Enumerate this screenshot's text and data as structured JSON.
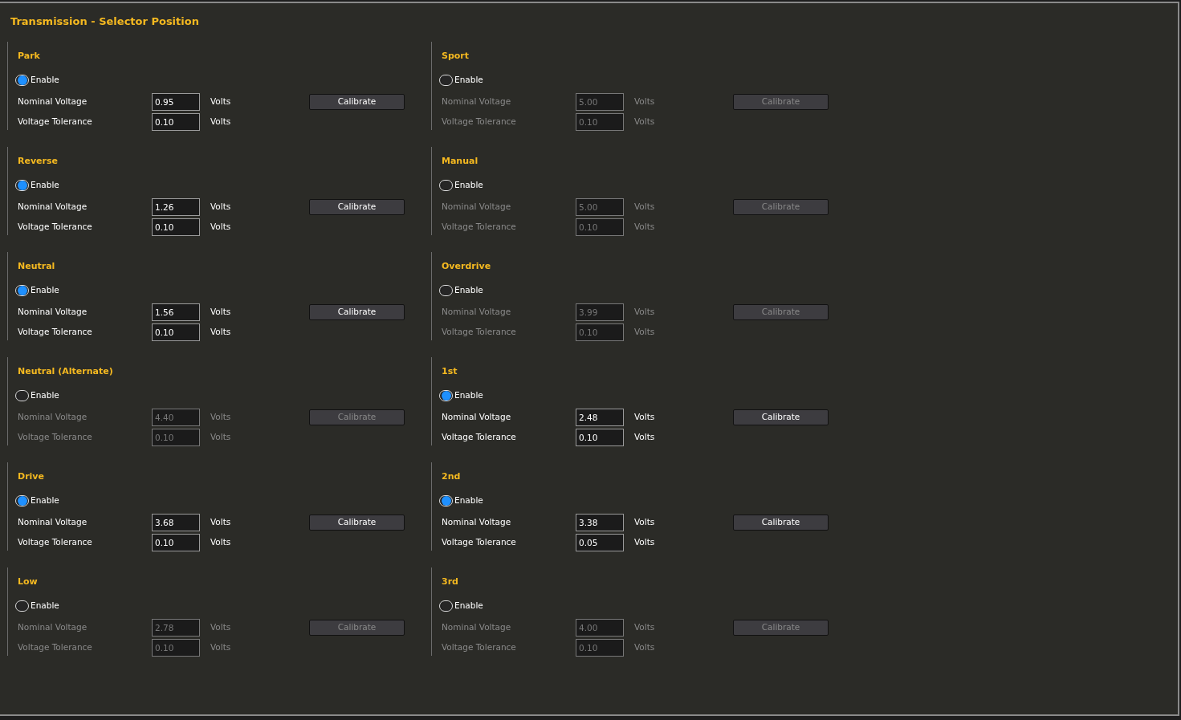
{
  "title": "Transmission - Selector Position",
  "sections": [
    {
      "name": "Park",
      "enabled": true,
      "enable_label": "Enable",
      "nominal_label": "Nominal Voltage",
      "nominal": "0.95",
      "nominal_unit": "Volts",
      "tolerance_label": "Voltage Tolerance",
      "tolerance": "0.10",
      "tolerance_unit": "Volts",
      "button": "Calibrate"
    },
    {
      "name": "Reverse",
      "enabled": true,
      "enable_label": "Enable",
      "nominal_label": "Nominal Voltage",
      "nominal": "1.26",
      "nominal_unit": "Volts",
      "tolerance_label": "Voltage Tolerance",
      "tolerance": "0.10",
      "tolerance_unit": "Volts",
      "button": "Calibrate"
    },
    {
      "name": "Neutral",
      "enabled": true,
      "enable_label": "Enable",
      "nominal_label": "Nominal Voltage",
      "nominal": "1.56",
      "nominal_unit": "Volts",
      "tolerance_label": "Voltage Tolerance",
      "tolerance": "0.10",
      "tolerance_unit": "Volts",
      "button": "Calibrate"
    },
    {
      "name": "Neutral (Alternate)",
      "enabled": false,
      "enable_label": "Enable",
      "nominal_label": "Nominal Voltage",
      "nominal": "4.40",
      "nominal_unit": "Volts",
      "tolerance_label": "Voltage Tolerance",
      "tolerance": "0.10",
      "tolerance_unit": "Volts",
      "button": "Calibrate"
    },
    {
      "name": "Drive",
      "enabled": true,
      "enable_label": "Enable",
      "nominal_label": "Nominal Voltage",
      "nominal": "3.68",
      "nominal_unit": "Volts",
      "tolerance_label": "Voltage Tolerance",
      "tolerance": "0.10",
      "tolerance_unit": "Volts",
      "button": "Calibrate"
    },
    {
      "name": "Low",
      "enabled": false,
      "enable_label": "Enable",
      "nominal_label": "Nominal Voltage",
      "nominal": "2.78",
      "nominal_unit": "Volts",
      "tolerance_label": "Voltage Tolerance",
      "tolerance": "0.10",
      "tolerance_unit": "Volts",
      "button": "Calibrate"
    },
    {
      "name": "Sport",
      "enabled": false,
      "enable_label": "Enable",
      "nominal_label": "Nominal Voltage",
      "nominal": "5.00",
      "nominal_unit": "Volts",
      "tolerance_label": "Voltage Tolerance",
      "tolerance": "0.10",
      "tolerance_unit": "Volts",
      "button": "Calibrate"
    },
    {
      "name": "Manual",
      "enabled": false,
      "enable_label": "Enable",
      "nominal_label": "Nominal Voltage",
      "nominal": "5.00",
      "nominal_unit": "Volts",
      "tolerance_label": "Voltage Tolerance",
      "tolerance": "0.10",
      "tolerance_unit": "Volts",
      "button": "Calibrate"
    },
    {
      "name": "Overdrive",
      "enabled": false,
      "enable_label": "Enable",
      "nominal_label": "Nominal Voltage",
      "nominal": "3.99",
      "nominal_unit": "Volts",
      "tolerance_label": "Voltage Tolerance",
      "tolerance": "0.10",
      "tolerance_unit": "Volts",
      "button": "Calibrate"
    },
    {
      "name": "1st",
      "enabled": true,
      "enable_label": "Enable",
      "nominal_label": "Nominal Voltage",
      "nominal": "2.48",
      "nominal_unit": "Volts",
      "tolerance_label": "Voltage Tolerance",
      "tolerance": "0.10",
      "tolerance_unit": "Volts",
      "button": "Calibrate"
    },
    {
      "name": "2nd",
      "enabled": true,
      "enable_label": "Enable",
      "nominal_label": "Nominal Voltage",
      "nominal": "3.38",
      "nominal_unit": "Volts",
      "tolerance_label": "Voltage Tolerance",
      "tolerance": "0.05",
      "tolerance_unit": "Volts",
      "button": "Calibrate"
    },
    {
      "name": "3rd",
      "enabled": false,
      "enable_label": "Enable",
      "nominal_label": "Nominal Voltage",
      "nominal": "4.00",
      "nominal_unit": "Volts",
      "tolerance_label": "Voltage Tolerance",
      "tolerance": "0.10",
      "tolerance_unit": "Volts",
      "button": "Calibrate"
    }
  ]
}
